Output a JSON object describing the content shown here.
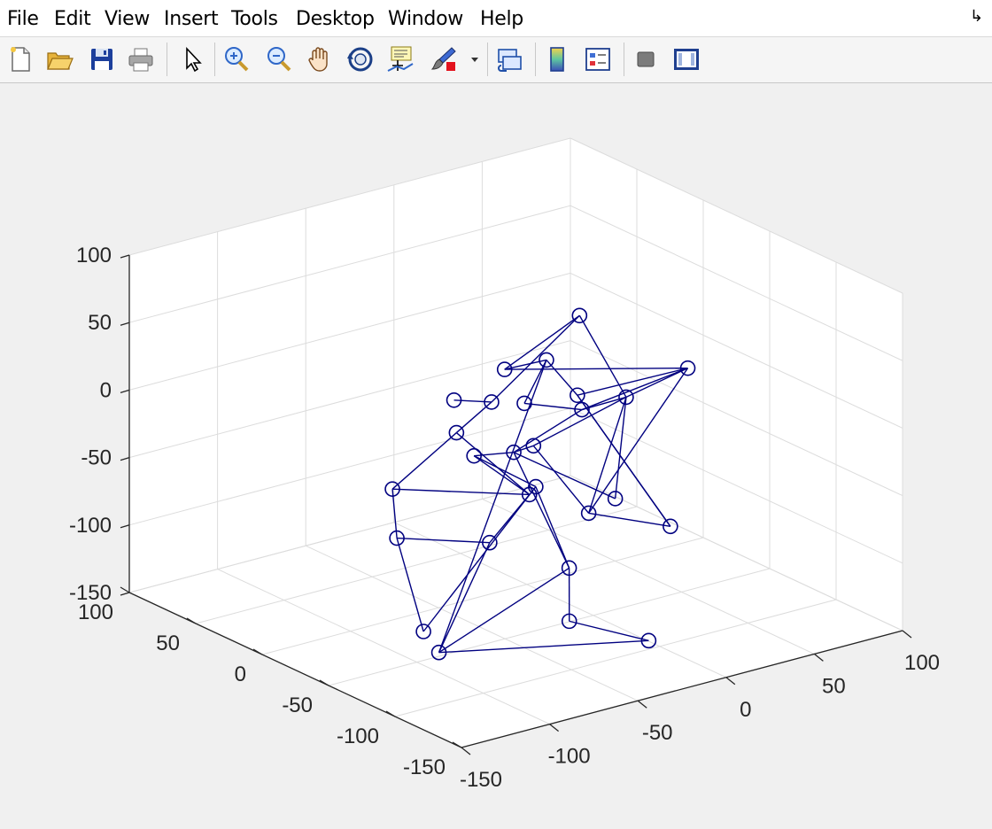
{
  "menu": {
    "items": [
      "File",
      "Edit",
      "View",
      "Insert",
      "Tools",
      "Desktop",
      "Window",
      "Help"
    ],
    "dock_icon": "dock-arrow-icon"
  },
  "toolbar": {
    "buttons": [
      {
        "name": "new-figure-button",
        "icon": "new-file-icon"
      },
      {
        "name": "open-file-button",
        "icon": "folder-open-icon"
      },
      {
        "name": "save-figure-button",
        "icon": "floppy-disk-icon"
      },
      {
        "name": "print-figure-button",
        "icon": "printer-icon"
      },
      {
        "name": "edit-plot-button",
        "icon": "pointer-arrow-icon"
      },
      {
        "name": "zoom-in-button",
        "icon": "zoom-in-icon"
      },
      {
        "name": "zoom-out-button",
        "icon": "zoom-out-icon"
      },
      {
        "name": "pan-button",
        "icon": "hand-icon"
      },
      {
        "name": "rotate-3d-button",
        "icon": "rotate-3d-icon"
      },
      {
        "name": "data-cursor-button",
        "icon": "data-cursor-icon"
      },
      {
        "name": "brush-button",
        "icon": "brush-icon"
      },
      {
        "name": "brush-dropdown-button",
        "icon": "dropdown-triangle-icon"
      },
      {
        "name": "link-plot-button",
        "icon": "link-plot-icon"
      },
      {
        "name": "insert-colorbar-button",
        "icon": "colorbar-icon"
      },
      {
        "name": "insert-legend-button",
        "icon": "legend-icon"
      },
      {
        "name": "hide-plot-tools-button",
        "icon": "hide-tools-icon"
      },
      {
        "name": "show-plot-tools-button",
        "icon": "show-tools-icon"
      }
    ]
  },
  "chart_data": {
    "type": "scatter3d-graph",
    "title": "",
    "xlabel": "",
    "ylabel": "",
    "zlabel": "",
    "axes": {
      "x_ticks": [
        "-150",
        "-100",
        "-50",
        "0",
        "50",
        "100"
      ],
      "y_ticks": [
        "-150",
        "-100",
        "-50",
        "0",
        "50",
        "100"
      ],
      "z_ticks": [
        "-150",
        "-100",
        "-50",
        "0",
        "50",
        "100"
      ],
      "xlim": [
        -150,
        100
      ],
      "ylim": [
        -150,
        100
      ],
      "zlim": [
        -150,
        100
      ],
      "grid": true,
      "box": false
    },
    "marker": "open-circle",
    "color": "#000080",
    "nodes_screen_order": "projected",
    "nodes": [
      {
        "id": 1,
        "x": 60,
        "y": 40,
        "z": 10
      },
      {
        "id": 2,
        "x": -70,
        "y": -40,
        "z": 5
      },
      {
        "id": 3,
        "x": 95,
        "y": 5,
        "z": -25
      },
      {
        "id": 4,
        "x": -95,
        "y": -25,
        "z": -35
      },
      {
        "id": 5,
        "x": -55,
        "y": -75,
        "z": -30
      },
      {
        "id": 6,
        "x": 55,
        "y": 35,
        "z": -45
      },
      {
        "id": 7,
        "x": -30,
        "y": 15,
        "z": -10
      },
      {
        "id": 8,
        "x": 10,
        "y": 30,
        "z": -8
      },
      {
        "id": 9,
        "x": 45,
        "y": -15,
        "z": -20
      },
      {
        "id": 10,
        "x": 35,
        "y": 5,
        "z": -35
      },
      {
        "id": 11,
        "x": -45,
        "y": -20,
        "z": -30
      },
      {
        "id": 12,
        "x": -20,
        "y": 0,
        "z": -8
      },
      {
        "id": 13,
        "x": 45,
        "y": 45,
        "z": -20
      },
      {
        "id": 14,
        "x": -30,
        "y": -30,
        "z": -28
      },
      {
        "id": 15,
        "x": 0,
        "y": -5,
        "z": -45
      },
      {
        "id": 16,
        "x": -100,
        "y": -35,
        "z": -65
      },
      {
        "id": 17,
        "x": -70,
        "y": -65,
        "z": -65
      },
      {
        "id": 18,
        "x": -10,
        "y": -20,
        "z": -65
      },
      {
        "id": 19,
        "x": 40,
        "y": 55,
        "z": -55
      },
      {
        "id": 20,
        "x": 20,
        "y": -40,
        "z": -75
      },
      {
        "id": 21,
        "x": -40,
        "y": -85,
        "z": -85
      },
      {
        "id": 22,
        "x": 20,
        "y": -20,
        "z": -95
      },
      {
        "id": 23,
        "x": -55,
        "y": -105,
        "z": -110
      },
      {
        "id": 24,
        "x": 55,
        "y": -35,
        "z": -110
      },
      {
        "id": 25,
        "x": -100,
        "y": -55,
        "z": -125
      },
      {
        "id": 26,
        "x": -95,
        "y": -60,
        "z": -140
      },
      {
        "id": 27,
        "x": -10,
        "y": -105,
        "z": -140
      }
    ],
    "edges": [
      [
        1,
        8
      ],
      [
        1,
        9
      ],
      [
        1,
        12
      ],
      [
        2,
        4
      ],
      [
        2,
        5
      ],
      [
        2,
        12
      ],
      [
        3,
        6
      ],
      [
        3,
        9
      ],
      [
        3,
        10
      ],
      [
        3,
        22
      ],
      [
        4,
        5
      ],
      [
        4,
        16
      ],
      [
        5,
        11
      ],
      [
        5,
        17
      ],
      [
        6,
        13
      ],
      [
        6,
        24
      ],
      [
        7,
        12
      ],
      [
        8,
        13
      ],
      [
        8,
        3
      ],
      [
        9,
        10
      ],
      [
        9,
        15
      ],
      [
        9,
        22
      ],
      [
        10,
        19
      ],
      [
        10,
        14
      ],
      [
        11,
        14
      ],
      [
        11,
        18
      ],
      [
        14,
        15
      ],
      [
        14,
        21
      ],
      [
        15,
        22
      ],
      [
        16,
        17
      ],
      [
        16,
        25
      ],
      [
        17,
        26
      ],
      [
        18,
        21
      ],
      [
        21,
        26
      ],
      [
        21,
        23
      ],
      [
        23,
        27
      ],
      [
        24,
        6
      ],
      [
        26,
        27
      ],
      [
        25,
        18
      ],
      [
        26,
        13
      ],
      [
        19,
        13
      ],
      [
        22,
        24
      ],
      [
        20,
        14
      ],
      [
        20,
        9
      ]
    ]
  }
}
